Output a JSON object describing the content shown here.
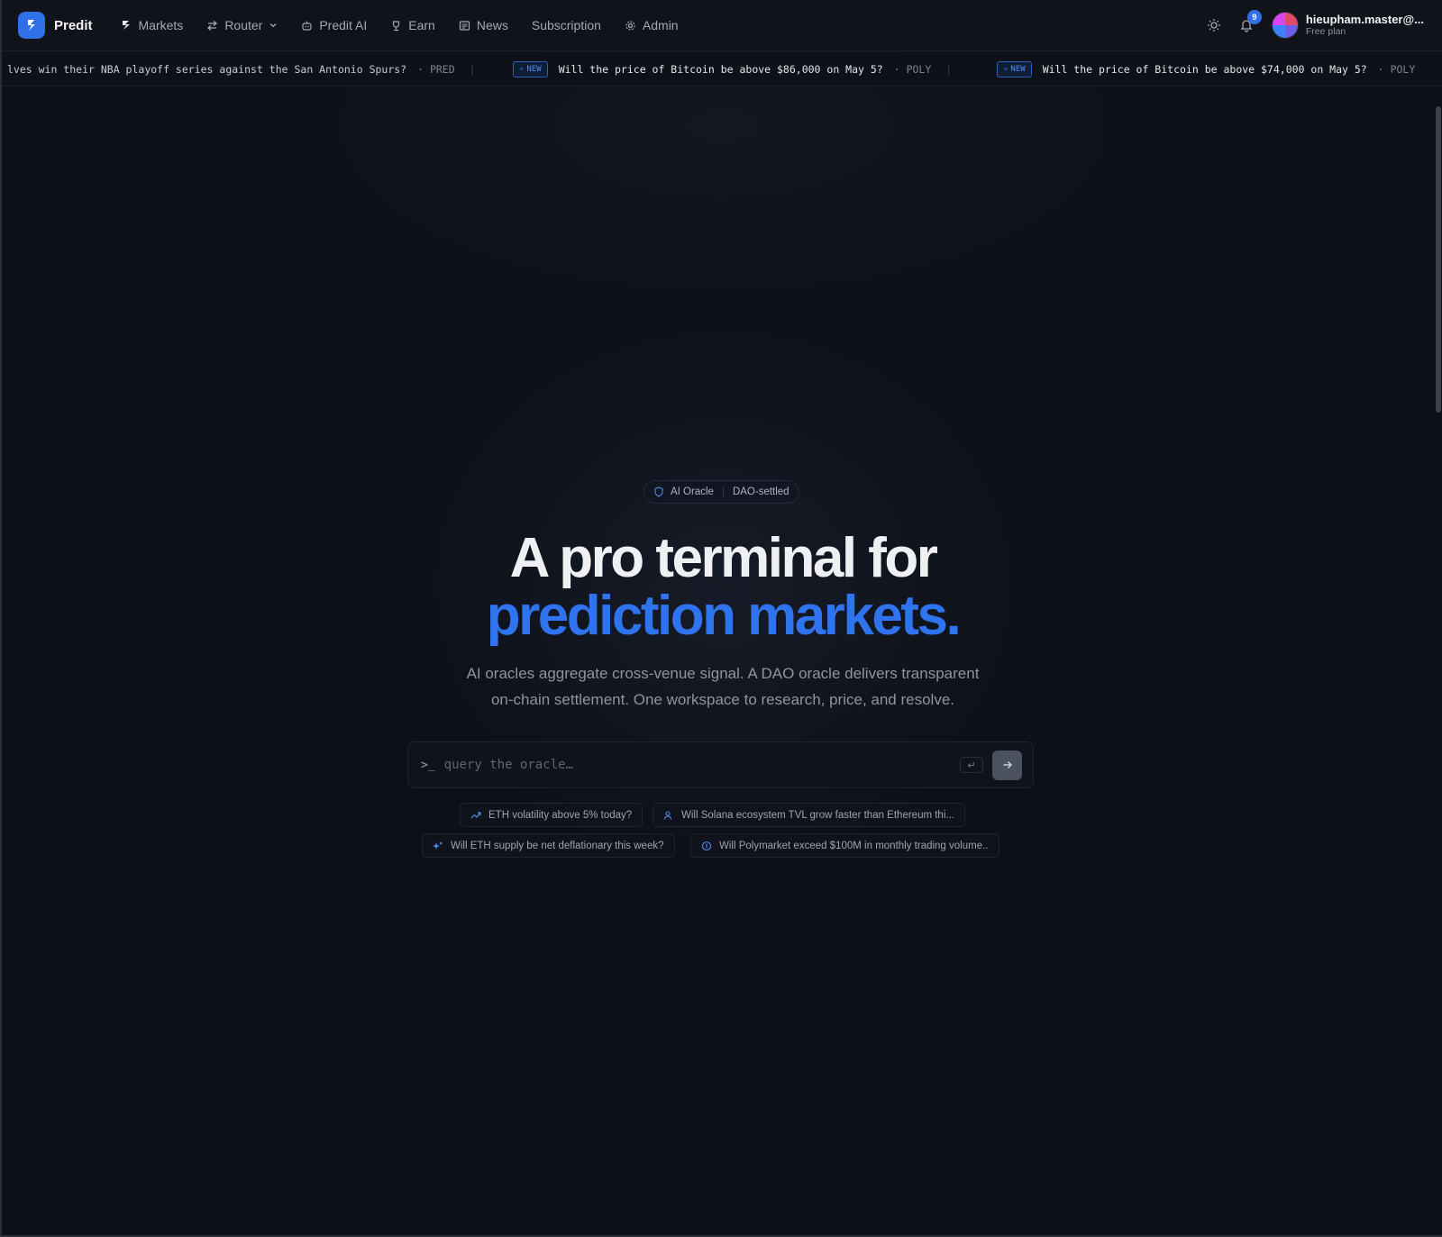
{
  "brand": {
    "name": "Predit"
  },
  "nav": {
    "items": [
      {
        "label": "Markets",
        "icon": "predit-mark-icon"
      },
      {
        "label": "Router",
        "icon": "router-icon",
        "dropdown": true
      },
      {
        "label": "Predit AI",
        "icon": "bot-icon"
      },
      {
        "label": "Earn",
        "icon": "trophy-icon"
      },
      {
        "label": "News",
        "icon": "newspaper-icon"
      },
      {
        "label": "Subscription",
        "icon": ""
      },
      {
        "label": "Admin",
        "icon": "gear-icon"
      }
    ],
    "notifications_count": "9",
    "user": {
      "name": "hieupham.master@...",
      "plan": "Free plan"
    }
  },
  "ticker": [
    {
      "text": "lves win their NBA playoff series against the San Antonio Spurs?",
      "source": "· PRED",
      "is_new": false
    },
    {
      "badge": "NEW",
      "text": "Will the price of Bitcoin be above $86,000 on May 5?",
      "source": "· POLY",
      "is_new": true
    },
    {
      "badge": "NEW",
      "text": "Will the price of Bitcoin be above $74,000 on May 5?",
      "source": "· POLY",
      "is_new": true
    }
  ],
  "hero": {
    "chip_primary": "AI Oracle",
    "chip_secondary": "DAO-settled",
    "title_line1": "A pro terminal for",
    "title_line2": "prediction markets.",
    "subtitle_line1": "AI oracles aggregate cross-venue signal. A DAO oracle delivers transparent",
    "subtitle_line2": "on-chain settlement. One workspace to research, price, and resolve."
  },
  "query": {
    "prompt": ">_",
    "placeholder": "query the oracle…",
    "enter_hint": "↵"
  },
  "suggestions": [
    {
      "label": "ETH volatility above 5% today?",
      "icon": "trending-up-icon"
    },
    {
      "label": "Will Solana ecosystem TVL grow faster than Ethereum thi...",
      "icon": "users-icon"
    },
    {
      "label": "Will ETH supply be net deflationary this week?",
      "icon": "sparkles-icon"
    },
    {
      "label": "Will Polymarket exceed $100M in monthly trading volume..",
      "icon": "coin-icon"
    }
  ],
  "colors": {
    "accent": "#2f74ee",
    "background": "#0d1017",
    "nav_background": "#101319"
  }
}
